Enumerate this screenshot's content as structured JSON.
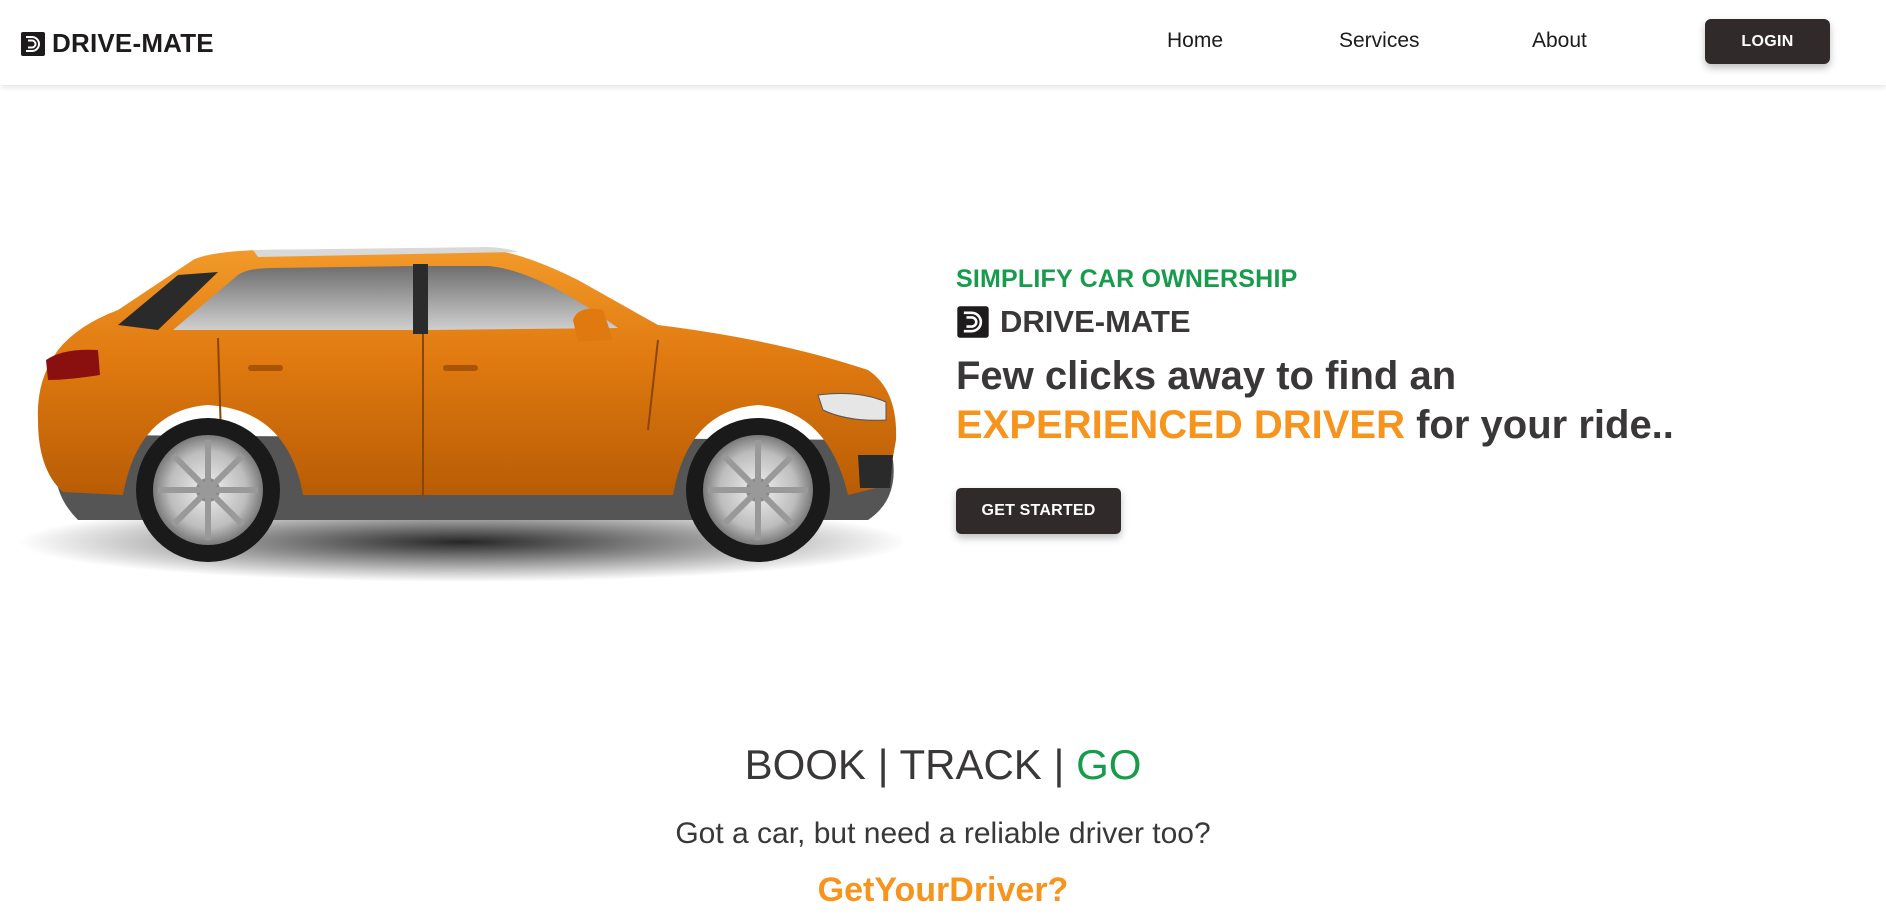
{
  "nav": {
    "brand": "DRIVE-MATE",
    "links": [
      "Home",
      "Services",
      "About"
    ],
    "login_label": "LOGIN"
  },
  "hero": {
    "tagline": "SIMPLIFY CAR OWNERSHIP",
    "brand": "DRIVE-MATE",
    "headline_line1": "Few clicks away to find an",
    "headline_highlight": "EXPERIENCED DRIVER",
    "headline_rest": " for your ride..",
    "cta_label": "GET STARTED",
    "image": "orange-suv-side-view"
  },
  "section": {
    "book": "BOOK",
    "sep1": " | ",
    "track": "TRACK",
    "sep2": " | ",
    "go": "GO",
    "question": "Got a car, but need a reliable driver too?",
    "cta_text": "GetYourDriver?"
  },
  "colors": {
    "accent_green": "#179b4c",
    "accent_orange": "#f7941d",
    "dark": "#312a2b",
    "text": "#3a3738"
  },
  "icons": {
    "logo": "drive-mate-logo-icon"
  }
}
